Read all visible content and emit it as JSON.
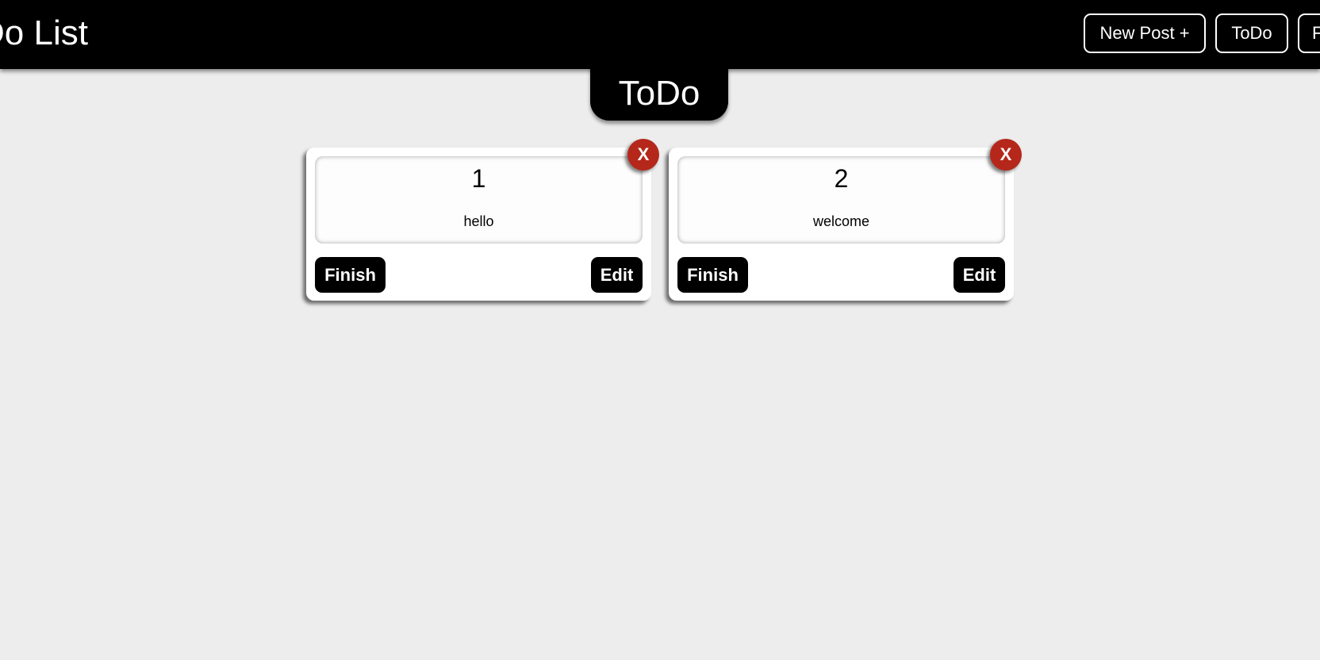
{
  "header": {
    "title": "Do List",
    "nav": [
      {
        "label": "New Post +"
      },
      {
        "label": "ToDo"
      },
      {
        "label": "F"
      }
    ]
  },
  "section": {
    "title": "ToDo"
  },
  "cards": [
    {
      "number": "1",
      "text": "hello",
      "finish_label": "Finish",
      "edit_label": "Edit",
      "delete_label": "X"
    },
    {
      "number": "2",
      "text": "welcome",
      "finish_label": "Finish",
      "edit_label": "Edit",
      "delete_label": "X"
    }
  ],
  "colors": {
    "header_bg": "#000000",
    "page_bg": "#ededed",
    "delete_button": "#b5271a",
    "card_bg": "#ffffff"
  }
}
